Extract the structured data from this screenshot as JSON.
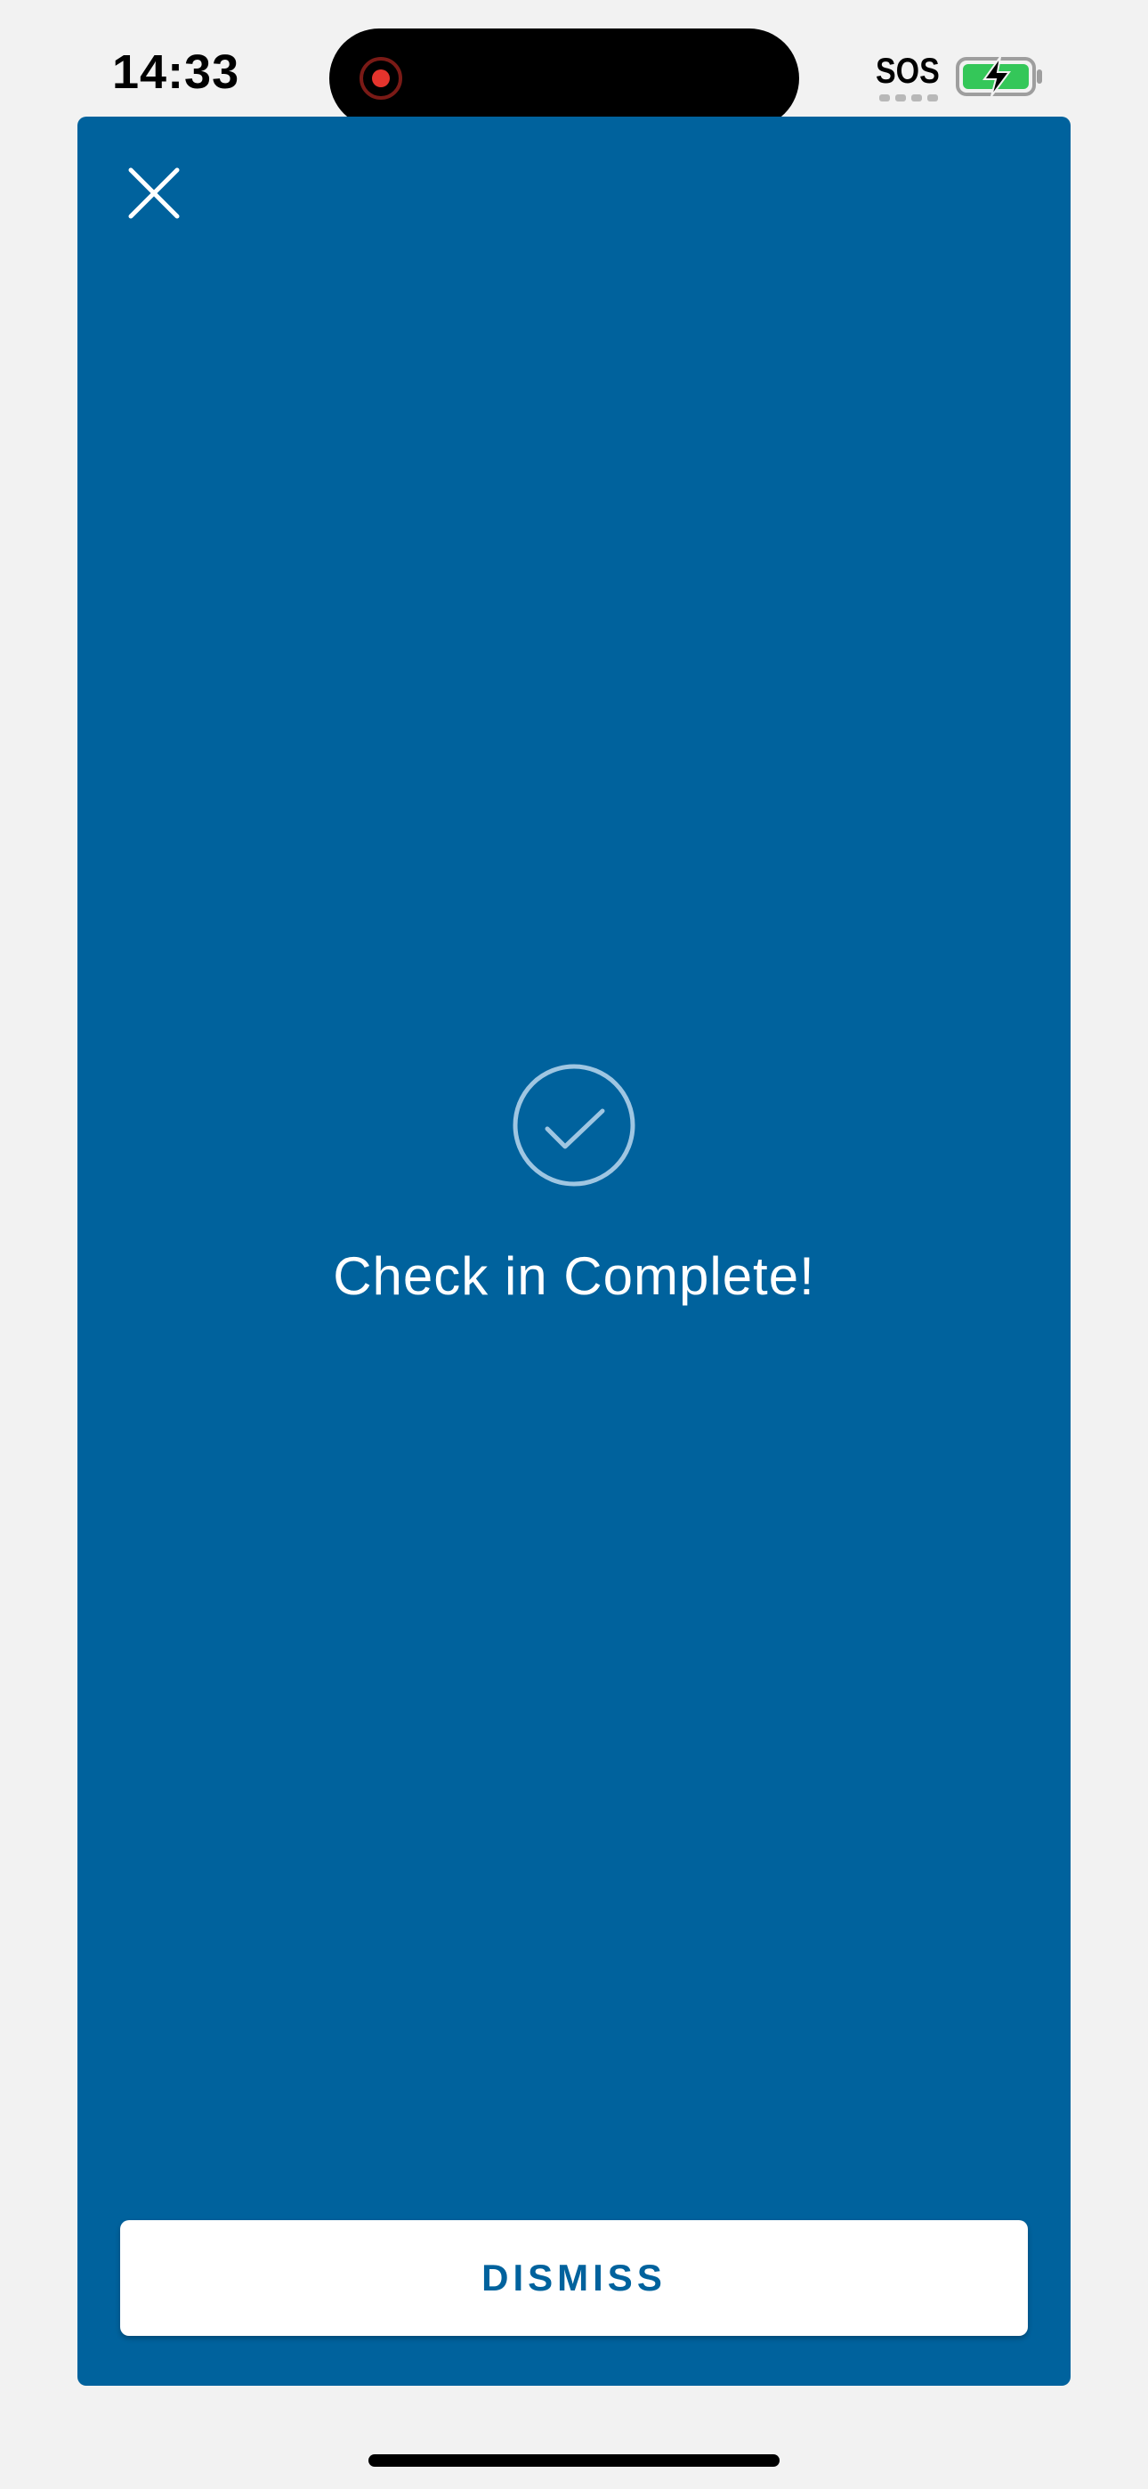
{
  "status_bar": {
    "time": "14:33",
    "carrier": "SOS",
    "battery_state": "charging",
    "recording_indicator_color": "#e5342d"
  },
  "modal": {
    "background_color": "#00629d",
    "close_icon": "close-icon",
    "status_icon": "check-circle-icon",
    "title": "Check in Complete!",
    "dismiss_label": "DISMISS"
  }
}
